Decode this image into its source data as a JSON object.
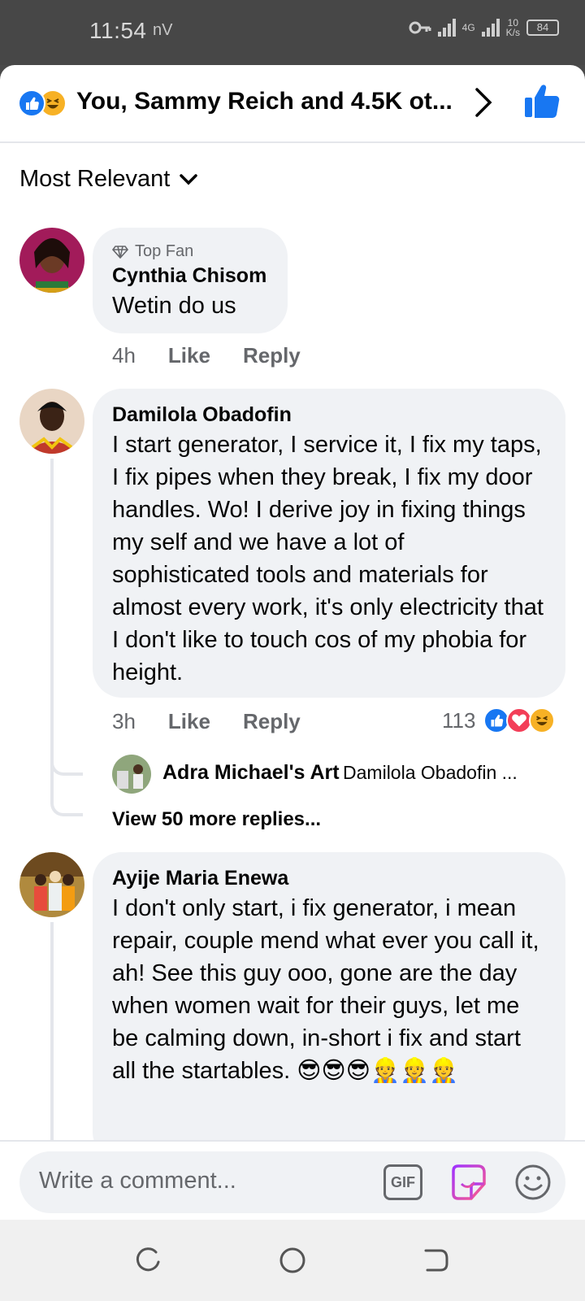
{
  "status_bar": {
    "time": "11:54",
    "left_icons": "nV",
    "network": "4G",
    "speed_value": "10",
    "speed_unit": "K/s",
    "battery": "84"
  },
  "header": {
    "title": "You, Sammy Reich and 4.5K ot..."
  },
  "sort": {
    "label": "Most Relevant"
  },
  "comments": [
    {
      "badge": "Top Fan",
      "author": "Cynthia Chisom",
      "text": "Wetin do us",
      "time": "4h",
      "like": "Like",
      "reply": "Reply"
    },
    {
      "author": "Damilola Obadofin",
      "text": "I start generator, I service it, I fix my taps, I fix pipes when they break, I fix my door handles. Wo! I derive joy in fixing things my self and we have a lot of sophisticated tools and materials for almost every work, it's only electricity that I don't like to touch cos of my phobia for height.",
      "time": "3h",
      "like": "Like",
      "reply": "Reply",
      "reaction_count": "113",
      "reply_preview": {
        "author": "Adra Michael's Art",
        "text": "Damilola Obadofin ..."
      },
      "view_more": "View 50 more replies..."
    },
    {
      "author": "Ayije Maria Enewa",
      "text": "I don't only start, i fix generator, i mean repair, couple mend what ever you call it, ah! See this guy ooo, gone are the day when women wait for their guys, let me be calming down, in-short i fix and start all the startables. 😎😎😎👷👷👷"
    }
  ],
  "composer": {
    "placeholder": "Write a comment...",
    "gif_label": "GIF"
  },
  "colors": {
    "facebook_blue": "#1877f2",
    "bubble_bg": "#f0f2f5",
    "secondary_text": "#65676b",
    "love_red": "#f33e58",
    "haha_yellow": "#f7b125"
  }
}
